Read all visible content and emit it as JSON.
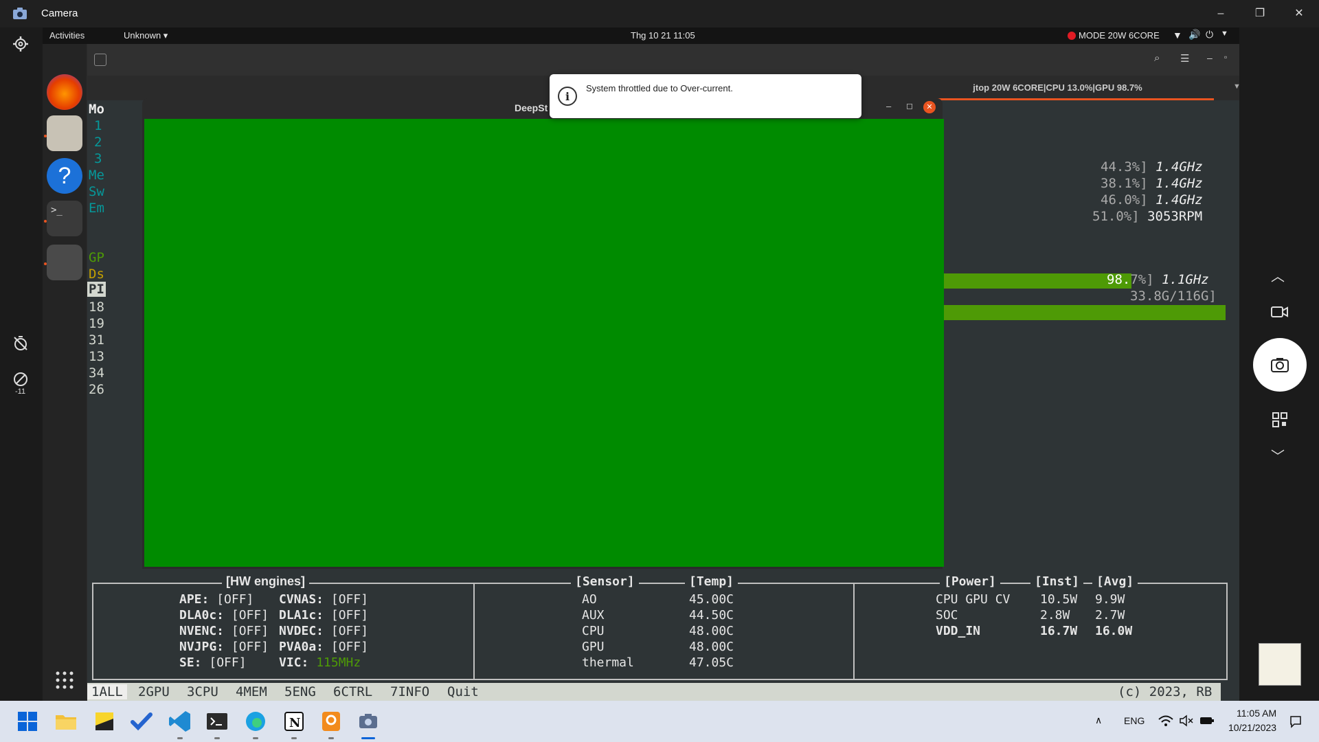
{
  "camera": {
    "title": "Camera",
    "minimize": "–",
    "maximize": "❐",
    "close": "✕",
    "timer_label": "-11"
  },
  "ubuntu_topbar": {
    "activities": "Activities",
    "app_menu": "Unknown ▾",
    "clock": "Thg 10 21  11:05",
    "mode": "MODE 20W 6CORE"
  },
  "notification": {
    "text": "System throttled due to Over-current."
  },
  "deepstream": {
    "title": "DeepSt"
  },
  "terminal": {
    "tab_title": "jtop 20W 6CORE|CPU 13.0%|GPU 98.7%",
    "left_fragments": [
      "Mo",
      "1",
      "2",
      "3",
      "Me",
      "Sw",
      "Em",
      "GP",
      "Ds",
      "PI",
      "18",
      "19",
      "31",
      "13",
      "34",
      "26"
    ],
    "cpu_rows": [
      {
        "pct": "44.3%]",
        "freq": "1.4GHz"
      },
      {
        "pct": "38.1%]",
        "freq": "1.4GHz"
      },
      {
        "pct": "46.0%]",
        "freq": "1.4GHz"
      }
    ],
    "fan": {
      "pct": "51.0%]",
      "rpm": "3053RPM"
    },
    "gpu": {
      "pct_a": "98.",
      "pct_b": "7%]",
      "freq": "1.1GHz"
    },
    "disk": "33.8G/116G]",
    "fan_bar_tail": "||",
    "hw_engines": {
      "title": "[HW engines]",
      "rows": [
        {
          "l": "APE:",
          "lv": "[OFF]",
          "r": "CVNAS:",
          "rv": "[OFF]"
        },
        {
          "l": "DLA0c:",
          "lv": "[OFF]",
          "r": "DLA1c:",
          "rv": "[OFF]"
        },
        {
          "l": "NVENC:",
          "lv": "[OFF]",
          "r": "NVDEC:",
          "rv": "[OFF]"
        },
        {
          "l": "NVJPG:",
          "lv": "[OFF]",
          "r": "PVA0a:",
          "rv": "[OFF]"
        },
        {
          "l": "SE:",
          "lv": "[OFF]",
          "r": "VIC:",
          "rv": "115MHz"
        }
      ]
    },
    "sensors": {
      "title_a": "[Sensor]",
      "title_b": "[Temp]",
      "rows": [
        {
          "name": "AO",
          "temp": "45.00C"
        },
        {
          "name": "AUX",
          "temp": "44.50C"
        },
        {
          "name": "CPU",
          "temp": "48.00C"
        },
        {
          "name": "GPU",
          "temp": "48.00C"
        },
        {
          "name": "thermal",
          "temp": "47.05C"
        }
      ]
    },
    "power": {
      "title_a": "[Power]",
      "title_b": "[Inst]",
      "title_c": "[Avg]",
      "rows": [
        {
          "name": "CPU GPU CV",
          "inst": "10.5W",
          "avg": "9.9W"
        },
        {
          "name": "SOC",
          "inst": "2.8W",
          "avg": "2.7W"
        },
        {
          "name": "VDD_IN",
          "inst": "16.7W",
          "avg": "16.0W"
        }
      ]
    },
    "menu": [
      "1ALL",
      "2GPU",
      "3CPU",
      "4MEM",
      "5ENG",
      "6CTRL",
      "7INFO",
      "Quit"
    ],
    "copyright": "(c) 2023, RB"
  },
  "taskbar": {
    "lang": "ENG",
    "time": "11:05 AM",
    "date": "10/21/2023"
  },
  "colors": {
    "video_green": "#008b00",
    "ubuntu_orange": "#e95420",
    "gpu_bar": "#4e9a06"
  }
}
